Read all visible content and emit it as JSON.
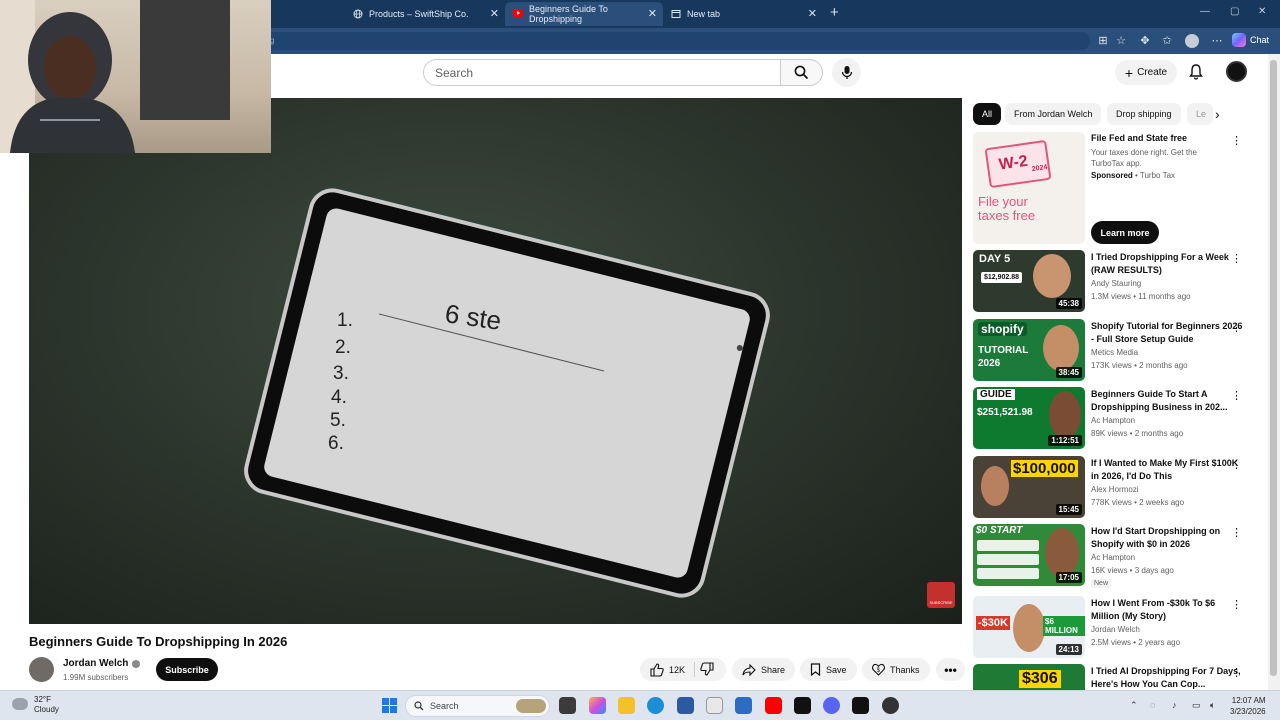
{
  "browser": {
    "tabs": [
      {
        "label": "Products – SwiftShip Co.",
        "active": false
      },
      {
        "label": "Beginners Guide To Dropshipping",
        "active": true
      },
      {
        "label": "New tab",
        "active": false
      }
    ],
    "address_fragment": "g",
    "chat_label": "Chat"
  },
  "header": {
    "search_placeholder": "Search",
    "create_label": "Create"
  },
  "video": {
    "title": "Beginners Guide To Dropshipping In 2026",
    "tablet_heading": "6 ste",
    "tablet_list": [
      "1.",
      "2.",
      "3.",
      "4.",
      "5.",
      "6."
    ],
    "watermark": "SUBSCRIBE"
  },
  "channel": {
    "name": "Jordan Welch",
    "subscribers": "1.99M subscribers",
    "subscribe_label": "Subscribe"
  },
  "actions": {
    "likes": "12K",
    "share": "Share",
    "save": "Save",
    "thanks": "Thanks"
  },
  "chips": [
    "All",
    "From Jordan Welch",
    "Drop shipping",
    "Le"
  ],
  "ad": {
    "title": "File Fed and State free",
    "description": "Your taxes done right. Get the TurboTax app.",
    "sponsored": "Sponsored",
    "advertiser": "Turbo Tax",
    "cta": "Learn more",
    "thumb_badge": "W-2",
    "thumb_year": "2024",
    "thumb_headline_1": "File your",
    "thumb_headline_2": "taxes free"
  },
  "recommendations": [
    {
      "title": "I Tried Dropshipping For a Week (RAW RESULTS)",
      "channel": "Andy Stauring",
      "meta": "1.3M views • 11 months ago",
      "duration": "45:38",
      "thumb_text": "DAY 5",
      "thumb_sub": "$12,902.88",
      "color": "#2e3a2d"
    },
    {
      "title": "Shopify Tutorial for Beginners 2026 - Full Store Setup Guide",
      "channel": "Metics Media",
      "meta": "173K views • 2 months ago",
      "duration": "38:45",
      "thumb_text": "shopify",
      "thumb_sub": "TUTORIAL 2026",
      "color": "#1c7a3b"
    },
    {
      "title": "Beginners Guide To Start A Dropshipping Business in 202...",
      "channel": "Ac Hampton",
      "meta": "89K views • 2 months ago",
      "duration": "1:12:51",
      "thumb_text": "GUIDE",
      "thumb_sub": "$251,521.98",
      "color": "#0e7a2f"
    },
    {
      "title": "If I Wanted to Make My First $100K in 2026, I'd Do This",
      "channel": "Alex Hormozi",
      "meta": "778K views • 2 weeks ago",
      "duration": "15:45",
      "thumb_text": "$100,000",
      "thumb_sub": "",
      "color": "#4a4236"
    },
    {
      "title": "How I'd Start Dropshipping on Shopify with $0 in 2026",
      "channel": "Ac Hampton",
      "meta": "16K views • 3 days ago",
      "duration": "17:05",
      "thumb_text": "$0 START",
      "thumb_sub": "",
      "color": "#2f8a3a",
      "badge": "New"
    },
    {
      "title": "How I Went From -$30k To $6 Million (My Story)",
      "channel": "Jordan Welch",
      "meta": "2.5M views • 2 years ago",
      "duration": "24:13",
      "thumb_text": "-$30K",
      "thumb_sub": "$6 MILLION",
      "color": "#e9eef3"
    },
    {
      "title": "I Tried AI Dropshipping For 7 Days, Here's How You Can Cop...",
      "channel": "",
      "meta": "",
      "duration": "",
      "thumb_text": "$306",
      "thumb_sub": "",
      "color": "#1f7a35"
    }
  ],
  "taskbar": {
    "temperature": "32°F",
    "condition": "Cloudy",
    "search_label": "Search",
    "time": "12:07 AM",
    "date": "3/23/2026"
  },
  "colors": {
    "tabstrip": "#17375d",
    "youtube_red": "#c4302b",
    "chip_active": "#0f0f0f"
  }
}
